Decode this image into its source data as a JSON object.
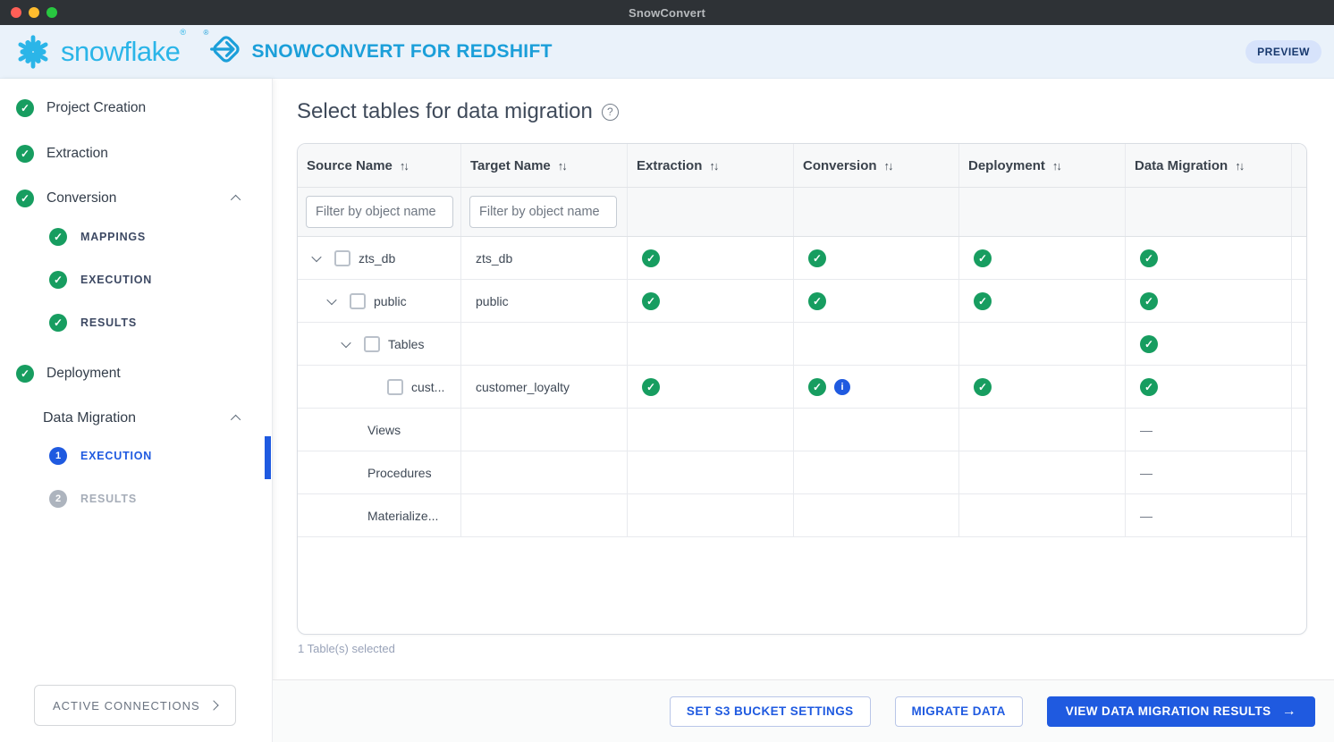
{
  "window": {
    "title": "SnowConvert"
  },
  "header": {
    "brand": "snowflake",
    "registered": "®",
    "app_title": "SNOWCONVERT FOR REDSHIFT",
    "preview_badge": "PREVIEW"
  },
  "icons": {
    "check": "✓",
    "info": "i",
    "dash": "—",
    "sort": "↑↓",
    "help": "?",
    "arrow_right": "→"
  },
  "sidebar": {
    "items": [
      {
        "label": "Project Creation",
        "status": "done"
      },
      {
        "label": "Extraction",
        "status": "done"
      },
      {
        "label": "Conversion",
        "status": "done",
        "expanded": true
      },
      {
        "label": "Deployment",
        "status": "done"
      },
      {
        "label": "Data Migration",
        "status": "in-progress",
        "expanded": true
      }
    ],
    "conversion_children": [
      {
        "label": "MAPPINGS",
        "status": "done"
      },
      {
        "label": "EXECUTION",
        "status": "done"
      },
      {
        "label": "RESULTS",
        "status": "done"
      }
    ],
    "data_migration_children": [
      {
        "label": "EXECUTION",
        "number": "1",
        "state": "active"
      },
      {
        "label": "RESULTS",
        "number": "2",
        "state": "disabled"
      }
    ],
    "active_connections_label": "ACTIVE CONNECTIONS"
  },
  "main": {
    "title": "Select tables for data migration",
    "table": {
      "columns": [
        "Source Name",
        "Target Name",
        "Extraction",
        "Conversion",
        "Deployment",
        "Data Migration"
      ],
      "filter_placeholder": "Filter by object name",
      "rows": [
        {
          "source": "zts_db",
          "target": "zts_db",
          "level": 0,
          "has_chevron": true,
          "has_checkbox": true,
          "checked": false,
          "extraction": "check",
          "conversion": "check",
          "deployment": "check",
          "data_migration": "check"
        },
        {
          "source": "public",
          "target": "public",
          "level": 1,
          "has_chevron": true,
          "has_checkbox": true,
          "checked": false,
          "extraction": "check",
          "conversion": "check",
          "deployment": "check",
          "data_migration": "check"
        },
        {
          "source": "Tables",
          "target": "",
          "level": 2,
          "has_chevron": true,
          "has_checkbox": true,
          "checked": false,
          "extraction": "",
          "conversion": "",
          "deployment": "",
          "data_migration": "check"
        },
        {
          "source": "cust...",
          "target": "customer_loyalty",
          "level": 3,
          "has_chevron": false,
          "has_checkbox": true,
          "checked": false,
          "extraction": "check",
          "conversion": "check info",
          "deployment": "check",
          "data_migration": "check"
        },
        {
          "source": "Views",
          "target": "",
          "level": 2,
          "has_chevron": false,
          "has_checkbox": false,
          "checked": false,
          "extraction": "",
          "conversion": "",
          "deployment": "",
          "data_migration": "dash"
        },
        {
          "source": "Procedures",
          "target": "",
          "level": 2,
          "has_chevron": false,
          "has_checkbox": false,
          "checked": false,
          "extraction": "",
          "conversion": "",
          "deployment": "",
          "data_migration": "dash"
        },
        {
          "source": "Materialize...",
          "target": "",
          "level": 2,
          "has_chevron": false,
          "has_checkbox": false,
          "checked": false,
          "extraction": "",
          "conversion": "",
          "deployment": "",
          "data_migration": "dash"
        }
      ],
      "selection_note": "1 Table(s) selected"
    },
    "actions": [
      {
        "label": "SET S3 BUCKET SETTINGS",
        "style": "outline"
      },
      {
        "label": "MIGRATE DATA",
        "style": "outline"
      },
      {
        "label": "VIEW DATA MIGRATION RESULTS",
        "style": "primary",
        "arrow": "→"
      }
    ]
  }
}
